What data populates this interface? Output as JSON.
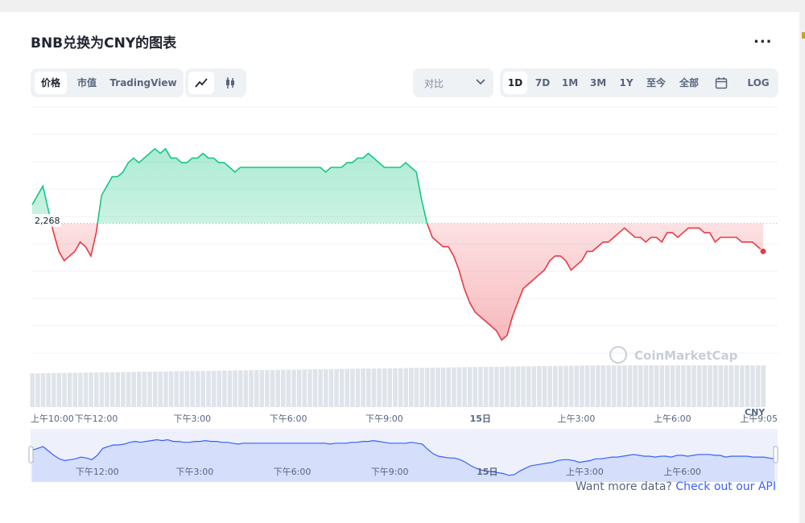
{
  "title": "BNB兑换为CNY的图表",
  "more_label": "...",
  "type_tabs": [
    {
      "label": "价格",
      "active": true
    },
    {
      "label": "市值",
      "active": false
    },
    {
      "label": "TradingView",
      "active": false
    }
  ],
  "chart_style_icons": [
    "line-chart-icon",
    "candlestick-icon"
  ],
  "compare": {
    "label": "对比"
  },
  "range_tabs": [
    {
      "label": "1D",
      "active": true
    },
    {
      "label": "7D",
      "active": false
    },
    {
      "label": "1M",
      "active": false
    },
    {
      "label": "3M",
      "active": false
    },
    {
      "label": "1Y",
      "active": false
    },
    {
      "label": "至今",
      "active": false
    },
    {
      "label": "全部",
      "active": false
    }
  ],
  "calendar_icon": "calendar-icon",
  "log_label": "LOG",
  "watermark": "CoinMarketCap",
  "api": {
    "prefix": "Want more data? ",
    "link": "Check out our API"
  },
  "colors": {
    "up": "#16c784",
    "down": "#ea3943",
    "accent": "#3861fb"
  },
  "chart_data": {
    "type": "line",
    "reference_label": "2,268",
    "reference_value": 2268,
    "currency_label": "CNY",
    "x_ticks": [
      "上午10:00",
      "下午12:00",
      "下午3:00",
      "下午6:00",
      "下午9:00",
      "15日",
      "上午3:00",
      "上午6:00",
      "上午9:05"
    ],
    "mini_ticks": [
      "下午12:00",
      "下午3:00",
      "下午6:00",
      "下午9:00",
      "15日",
      "上午3:00",
      "上午6:00"
    ],
    "x": [
      "上午10:00",
      "",
      "",
      "",
      "",
      "",
      "",
      "",
      "",
      "",
      "",
      "",
      "下午12:00",
      "",
      "",
      "",
      "",
      "",
      "",
      "",
      "",
      "",
      "",
      "",
      "",
      "",
      "",
      "",
      "",
      "",
      "下午3:00",
      "",
      "",
      "",
      "",
      "",
      "",
      "",
      "",
      "",
      "",
      "",
      "",
      "",
      "",
      "",
      "",
      "",
      "下午6:00",
      "",
      "",
      "",
      "",
      "",
      "",
      "",
      "",
      "",
      "",
      "",
      "",
      "",
      "",
      "",
      "",
      "",
      "下午9:00",
      "",
      "",
      "",
      "",
      "",
      "",
      "",
      "",
      "",
      "",
      "",
      "",
      "",
      "",
      "",
      "",
      "",
      "15日",
      "",
      "",
      "",
      "",
      "",
      "",
      "",
      "",
      "",
      "",
      "",
      "",
      "",
      "",
      "",
      "",
      "",
      "上午3:00",
      "",
      "",
      "",
      "",
      "",
      "",
      "",
      "",
      "",
      "",
      "",
      "",
      "",
      "",
      "",
      "",
      "",
      "上午6:00",
      "",
      "",
      "",
      "",
      "",
      "",
      "",
      "",
      "",
      "",
      "",
      "",
      "",
      "",
      "",
      "",
      "",
      "上午9:05"
    ],
    "values": [
      2272,
      2274,
      2276,
      2271,
      2266,
      2262,
      2260,
      2261,
      2262,
      2264,
      2263,
      2261,
      2266,
      2274,
      2276,
      2278,
      2278,
      2279,
      2281,
      2282,
      2281,
      2282,
      2283,
      2284,
      2283,
      2284,
      2282,
      2282,
      2281,
      2281,
      2282,
      2282,
      2283,
      2282,
      2282,
      2281,
      2281,
      2280,
      2279,
      2280,
      2280,
      2280,
      2280,
      2280,
      2280,
      2280,
      2280,
      2280,
      2280,
      2280,
      2280,
      2280,
      2280,
      2280,
      2280,
      2279,
      2280,
      2280,
      2280,
      2281,
      2281,
      2282,
      2282,
      2283,
      2282,
      2281,
      2280,
      2280,
      2280,
      2280,
      2281,
      2280,
      2279,
      2273,
      2268,
      2265,
      2264,
      2263,
      2263,
      2261,
      2258,
      2254,
      2251,
      2249,
      2248,
      2247,
      2246,
      2245,
      2243,
      2244,
      2248,
      2251,
      2254,
      2255,
      2256,
      2257,
      2258,
      2260,
      2261,
      2261,
      2260,
      2258,
      2259,
      2260,
      2262,
      2262,
      2263,
      2264,
      2264,
      2265,
      2266,
      2267,
      2266,
      2265,
      2265,
      2264,
      2265,
      2265,
      2264,
      2266,
      2266,
      2265,
      2266,
      2267,
      2267,
      2267,
      2266,
      2266,
      2264,
      2265,
      2265,
      2265,
      2265,
      2264,
      2264,
      2264,
      2263,
      2262
    ],
    "ylim": [
      2240,
      2290
    ]
  }
}
